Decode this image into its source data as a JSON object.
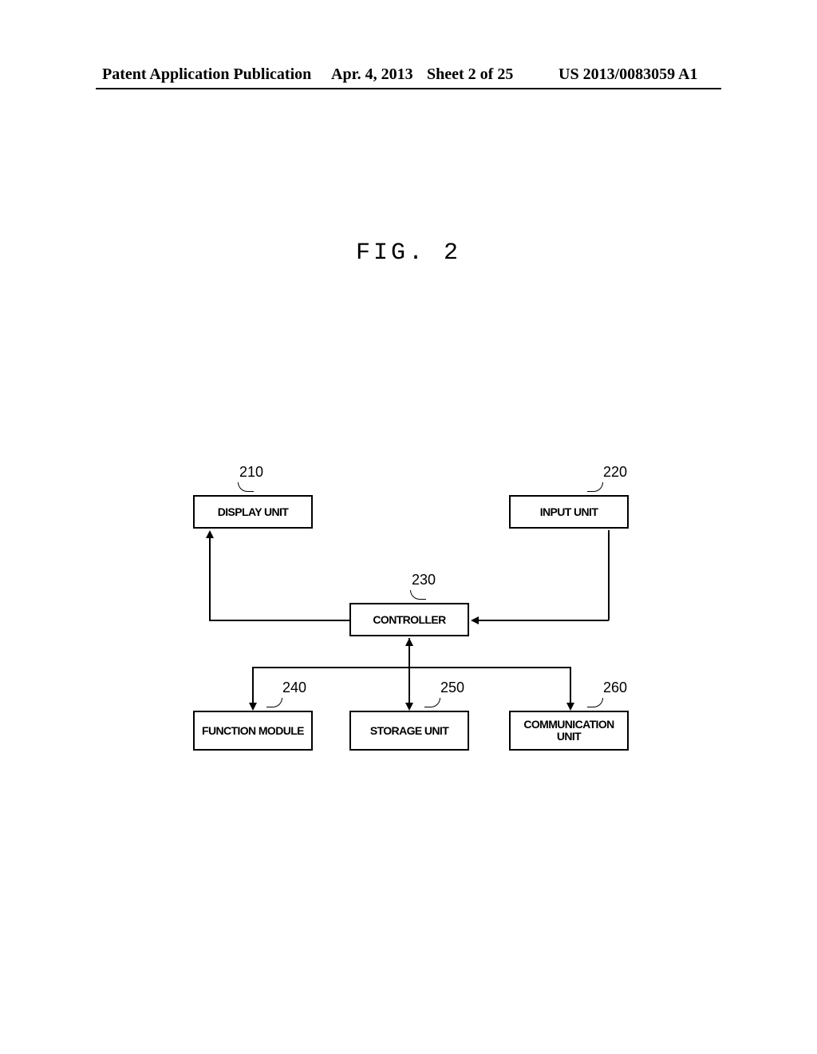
{
  "header": {
    "pub": "Patent Application Publication",
    "date": "Apr. 4, 2013",
    "sheet": "Sheet 2 of 25",
    "docno": "US 2013/0083059 A1"
  },
  "figure": {
    "label": "FIG. 2"
  },
  "blocks": {
    "display": {
      "ref": "210",
      "label": "DISPLAY UNIT"
    },
    "input": {
      "ref": "220",
      "label": "INPUT UNIT"
    },
    "controller": {
      "ref": "230",
      "label": "CONTROLLER"
    },
    "function": {
      "ref": "240",
      "label": "FUNCTION MODULE"
    },
    "storage": {
      "ref": "250",
      "label": "STORAGE UNIT"
    },
    "comm": {
      "ref": "260",
      "label": "COMMUNICATION\nUNIT"
    }
  }
}
